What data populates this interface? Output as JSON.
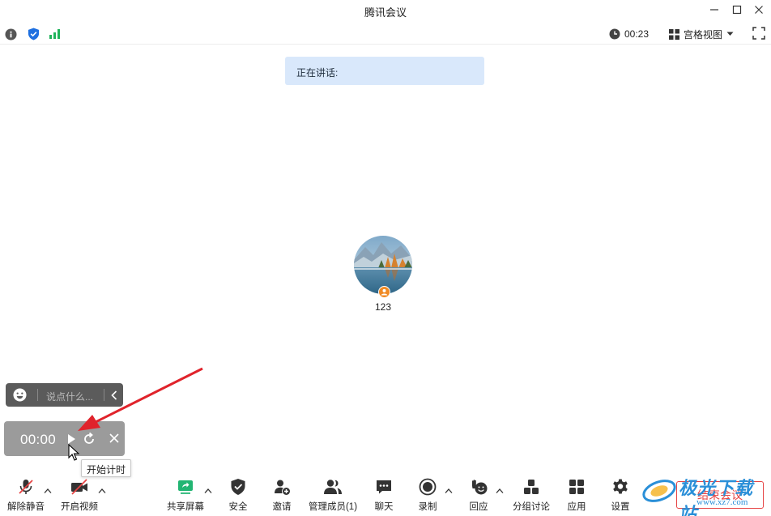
{
  "window": {
    "title": "腾讯会议"
  },
  "infobar": {
    "duration": "00:23",
    "view_mode": "宫格视图"
  },
  "speaking": {
    "label": "正在讲话:"
  },
  "participant": {
    "name": "123"
  },
  "chat": {
    "placeholder": "说点什么..."
  },
  "stopwatch": {
    "time": "00:00",
    "tooltip": "开始计时"
  },
  "toolbar": {
    "unmute": "解除静音",
    "start_video": "开启视频",
    "share_screen": "共享屏幕",
    "security": "安全",
    "invite": "邀请",
    "manage_members": "管理成员(1)",
    "chat": "聊天",
    "record": "录制",
    "react": "回应",
    "breakout": "分组讨论",
    "apps": "应用",
    "settings": "设置",
    "end_meeting": "结束会议"
  },
  "watermark": {
    "text": "极光下载站",
    "url": "www.xz7.com"
  },
  "colors": {
    "accent_blue": "#1e6fe0",
    "signal_green": "#1fb35a",
    "share_green": "#22b573",
    "end_red": "#e64343",
    "speaking_bg": "#d9e8fb"
  }
}
